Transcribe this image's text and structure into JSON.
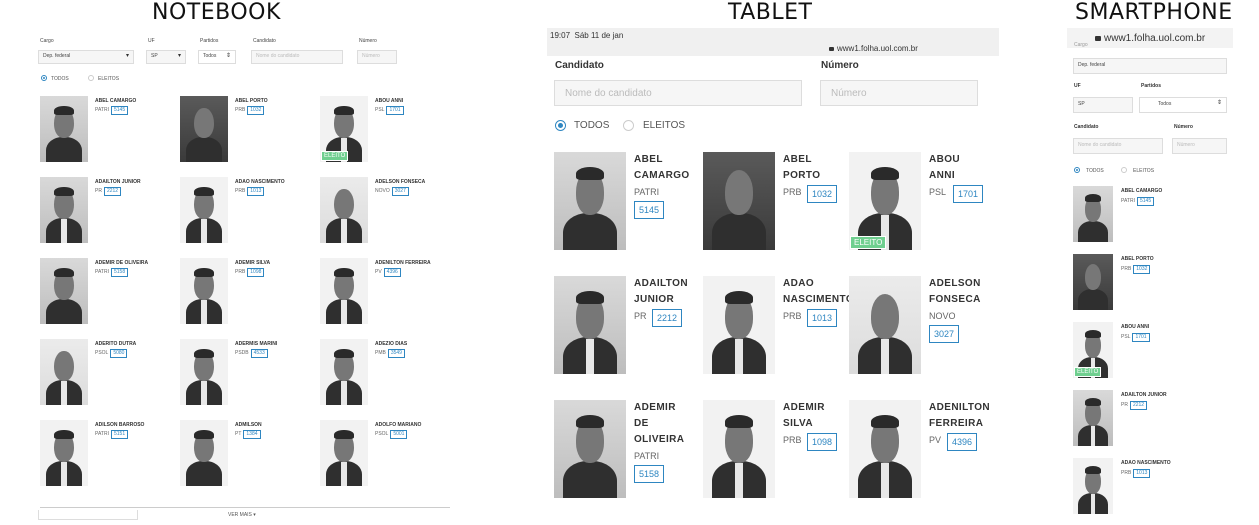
{
  "titles": {
    "notebook": "NOTEBOOK",
    "tablet": "TABLET",
    "smartphone": "SMARTPHONE"
  },
  "colors": {
    "accent": "#2e86c1",
    "eleito": "#6fcf8f"
  },
  "notebook": {
    "filters": {
      "cargo_label": "Cargo",
      "cargo_value": "Dep. federal",
      "uf_label": "UF",
      "uf_value": "SP",
      "partidos_label": "Partidos",
      "partidos_value": "Todos",
      "candidato_label": "Candidato",
      "candidato_placeholder": "Nome do candidato",
      "numero_label": "Número",
      "numero_placeholder": "Número"
    },
    "radios": {
      "todos": "TODOS",
      "eleitos": "ELEITOS"
    },
    "candidates": [
      {
        "name": "ABEL CAMARGO",
        "party": "PATRI",
        "number": "5145"
      },
      {
        "name": "ABEL PORTO",
        "party": "PRB",
        "number": "1032"
      },
      {
        "name": "ABOU ANNI",
        "party": "PSL",
        "number": "1701",
        "badge": "ELEITO"
      },
      {
        "name": "ADAILTON JUNIOR",
        "party": "PR",
        "number": "2212"
      },
      {
        "name": "ADAO NASCIMENTO",
        "party": "PRB",
        "number": "1013"
      },
      {
        "name": "ADELSON FONSECA",
        "party": "NOVO",
        "number": "3027"
      },
      {
        "name": "ADEMIR DE OLIVEIRA",
        "party": "PATRI",
        "number": "5158"
      },
      {
        "name": "ADEMIR SILVA",
        "party": "PRB",
        "number": "1098"
      },
      {
        "name": "ADENILTON FERREIRA",
        "party": "PV",
        "number": "4396"
      },
      {
        "name": "ADERITO DUTRA",
        "party": "PSOL",
        "number": "5080"
      },
      {
        "name": "ADERMIS MARINI",
        "party": "PSDB",
        "number": "4533"
      },
      {
        "name": "ADEZIO DIAS",
        "party": "PMB",
        "number": "3549"
      },
      {
        "name": "ADILSON BARROSO",
        "party": "PATRI",
        "number": "5151"
      },
      {
        "name": "ADMILSON",
        "party": "PT",
        "number": "1384"
      },
      {
        "name": "ADOLFO MARIANO",
        "party": "PSOL",
        "number": "5001"
      }
    ],
    "ver_mais": "VER MAIS",
    "ver_mais_icon": "chevron-down-icon"
  },
  "tablet": {
    "status_time": "19:07",
    "status_date": "Sáb 11 de jan",
    "url": "www1.folha.uol.com.br",
    "candidato_label": "Candidato",
    "candidato_placeholder": "Nome do candidato",
    "numero_label": "Número",
    "numero_placeholder": "Número",
    "radios": {
      "todos": "TODOS",
      "eleitos": "ELEITOS"
    },
    "candidates": [
      {
        "name": [
          "ABEL",
          "CAMARGO"
        ],
        "party": "PATRI",
        "number": "5145"
      },
      {
        "name": [
          "ABEL",
          "PORTO"
        ],
        "party": "PRB",
        "number": "1032"
      },
      {
        "name": [
          "ABOU",
          "ANNI"
        ],
        "party": "PSL",
        "number": "1701",
        "badge": "ELEITO"
      },
      {
        "name": [
          "ADAILTON",
          "JUNIOR"
        ],
        "party": "PR",
        "number": "2212"
      },
      {
        "name": [
          "ADAO",
          "NASCIMENTO"
        ],
        "party": "PRB",
        "number": "1013"
      },
      {
        "name": [
          "ADELSON",
          "FONSECA"
        ],
        "party": "NOVO",
        "number": "3027"
      },
      {
        "name": [
          "ADEMIR",
          "DE",
          "OLIVEIRA"
        ],
        "party": "PATRI",
        "number": "5158"
      },
      {
        "name": [
          "ADEMIR",
          "SILVA"
        ],
        "party": "PRB",
        "number": "1098"
      },
      {
        "name": [
          "ADENILTON",
          "FERREIRA"
        ],
        "party": "PV",
        "number": "4396"
      }
    ]
  },
  "smartphone": {
    "url": "www1.folha.uol.com.br",
    "cargo_label": "Cargo",
    "cargo_value": "Dep. federal",
    "uf_label": "UF",
    "uf_value": "SP",
    "partidos_label": "Partidos",
    "partidos_value": "Todos",
    "candidato_label": "Candidato",
    "candidato_placeholder": "Nome do candidato",
    "numero_label": "Número",
    "numero_placeholder": "Número",
    "radios": {
      "todos": "TODOS",
      "eleitos": "ELEITOS"
    },
    "candidates": [
      {
        "name": "ABEL CAMARGO",
        "party": "PATRI",
        "number": "5145"
      },
      {
        "name": "ABEL PORTO",
        "party": "PRB",
        "number": "1032"
      },
      {
        "name": "ABOU ANNI",
        "party": "PSL",
        "number": "1701",
        "badge": "ELEITO"
      },
      {
        "name": "ADAILTON JUNIOR",
        "party": "PR",
        "number": "2212"
      },
      {
        "name": "ADAO NASCIMENTO",
        "party": "PRB",
        "number": "1013"
      }
    ]
  }
}
